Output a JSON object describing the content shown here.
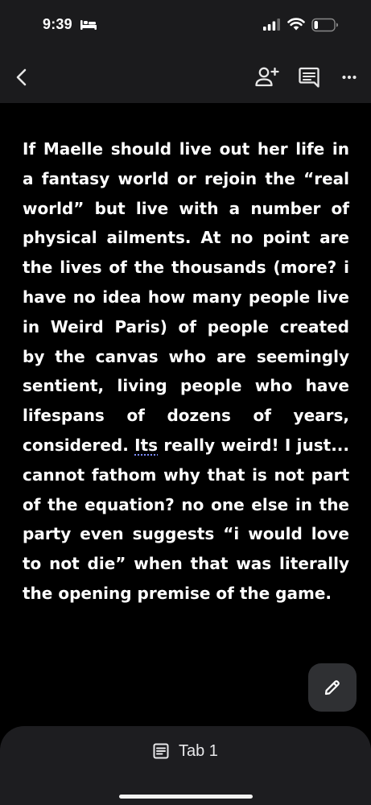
{
  "status_bar": {
    "time": "9:39",
    "icons": [
      "bed-icon",
      "signal-icon",
      "wifi-icon",
      "battery-icon"
    ]
  },
  "toolbar": {
    "icons": [
      "back-chevron-icon",
      "add-person-icon",
      "comment-icon",
      "more-options-icon"
    ]
  },
  "document": {
    "body_before_flag": "If Maelle should live out her life in a fantasy world or rejoin the “real world” but live with a number of physical ailments. At no point are the lives of the thousands (more? i have no idea how many people live in Weird Paris) of people created by the canvas who are seemingly sentient, living people who have lifespans of dozens of years, considered. ",
    "flagged_word": "Its",
    "body_after_flag": " really weird! I just... cannot fathom why that is not part of the equation? no one else in the party even suggests “i would love to not die” when that was literally the opening premise of the game."
  },
  "fab": {
    "icon": "pencil-icon"
  },
  "bottom_bar": {
    "tab_icon": "document-icon",
    "tab_label": "Tab 1"
  },
  "colors": {
    "background": "#000000",
    "bars": "#1b1b1d",
    "text": "#ffffff",
    "fab": "#2f3033",
    "spellcheck_underline": "#7c8cff"
  }
}
